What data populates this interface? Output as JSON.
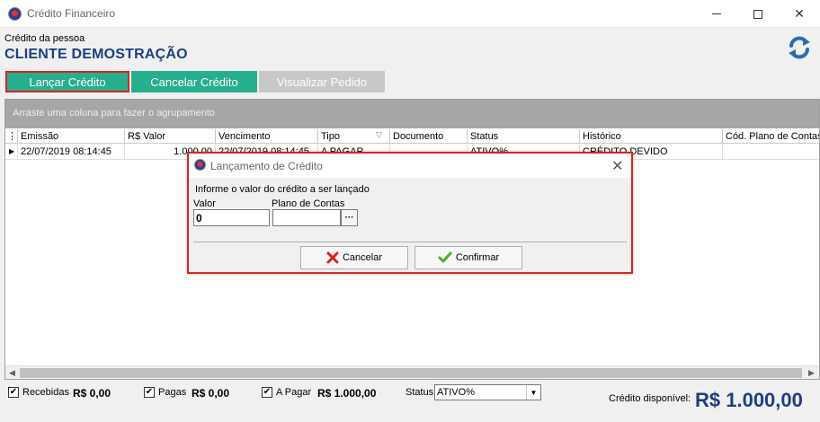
{
  "window": {
    "title": "Crédito Financeiro"
  },
  "person": {
    "caption": "Crédito da pessoa",
    "name": "CLIENTE DEMOSTRAÇÃO"
  },
  "tabs": [
    {
      "label": "Lançar Crédito",
      "state": "selected"
    },
    {
      "label": "Cancelar Crédito",
      "state": "normal"
    },
    {
      "label": "Visualizar Pedido",
      "state": "disabled"
    }
  ],
  "grid": {
    "group_hint": "Arraste uma coluna para fazer o agrupamento",
    "columns": [
      "Emissão",
      "R$ Valor",
      "Vencimento",
      "Tipo",
      "Documento",
      "Status",
      "Histórico",
      "Cód. Plano de Contas"
    ],
    "rows": [
      {
        "emissao": "22/07/2019 08:14:45",
        "valor": "1.000,00",
        "vencimento": "22/07/2019 08:14:45",
        "tipo": "A PAGAR",
        "documento": "",
        "status": "ATIVO%",
        "historico": "CRÉDITO DEVIDO",
        "plano": ""
      }
    ]
  },
  "footer": {
    "recebidas": {
      "label": "Recebidas",
      "value": "R$ 0,00",
      "checked": true
    },
    "pagas": {
      "label": "Pagas",
      "value": "R$ 0,00",
      "checked": true
    },
    "apagar": {
      "label": "A Pagar",
      "value": "R$ 1.000,00",
      "checked": true
    },
    "status_label": "Status",
    "status_value": "ATIVO%",
    "credit_label": "Crédito disponível:",
    "credit_value": "R$ 1.000,00"
  },
  "dialog": {
    "title": "Lançamento de Crédito",
    "instruction": "Informe o valor do crédito a ser lançado",
    "valor_label": "Valor",
    "valor_value": "0",
    "plano_label": "Plano de Contas",
    "plano_value": "",
    "plano_button": "···",
    "cancel_label": "Cancelar",
    "confirm_label": "Confirmar"
  },
  "colors": {
    "accent_green": "#27ae8e",
    "brand_blue": "#1c3f83",
    "highlight_red": "#dd2222"
  }
}
